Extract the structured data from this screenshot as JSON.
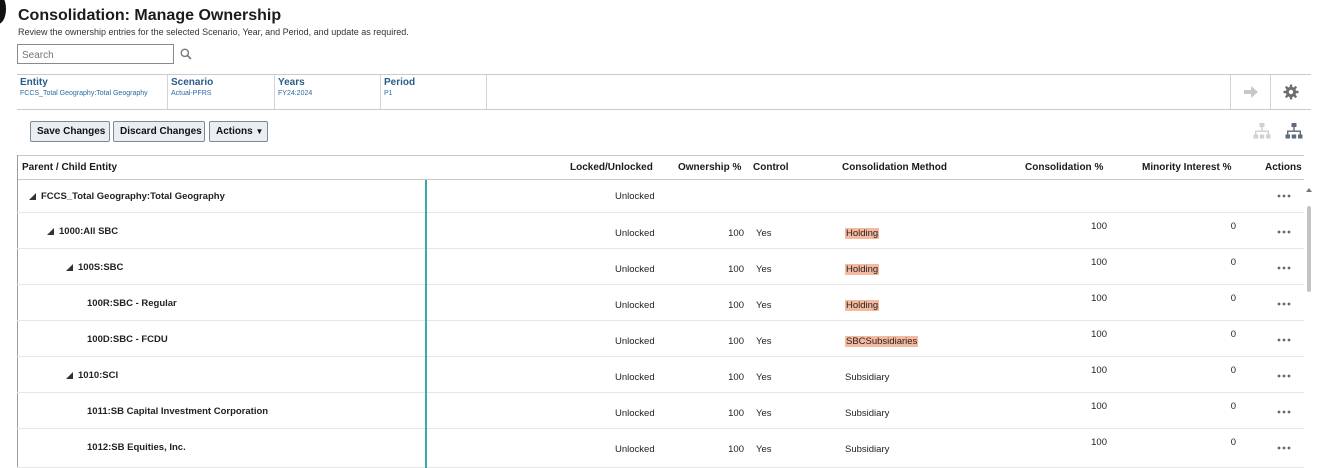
{
  "header": {
    "title": "Consolidation: Manage Ownership",
    "description": "Review the ownership entries for the selected Scenario, Year, and Period, and update as required."
  },
  "search": {
    "placeholder": "Search"
  },
  "pov": [
    {
      "label": "Entity",
      "value": "FCCS_Total Geography:Total Geography"
    },
    {
      "label": "Scenario",
      "value": "Actual-PFRS"
    },
    {
      "label": "Years",
      "value": "FY24:2024"
    },
    {
      "label": "Period",
      "value": "P1"
    }
  ],
  "toolbar": {
    "save_label": "Save Changes",
    "discard_label": "Discard Changes",
    "actions_label": "Actions"
  },
  "grid": {
    "columns": {
      "entity": "Parent / Child Entity",
      "locked": "Locked/Unlocked",
      "ownership": "Ownership %",
      "control": "Control",
      "method": "Consolidation Method",
      "consolidation": "Consolidation %",
      "minority": "Minority Interest %",
      "actions": "Actions"
    },
    "rows": [
      {
        "entity": "FCCS_Total Geography:Total Geography",
        "level": 0,
        "expanded": true,
        "locked": "Unlocked",
        "ownership": "",
        "control": "",
        "method": "",
        "highlight": false,
        "consolidation": "",
        "minority": ""
      },
      {
        "entity": "1000:All SBC",
        "level": 1,
        "expanded": true,
        "locked": "Unlocked",
        "ownership": "100",
        "control": "Yes",
        "method": "Holding",
        "highlight": true,
        "consolidation": "100",
        "minority": "0"
      },
      {
        "entity": "100S:SBC",
        "level": 2,
        "expanded": true,
        "locked": "Unlocked",
        "ownership": "100",
        "control": "Yes",
        "method": "Holding",
        "highlight": true,
        "consolidation": "100",
        "minority": "0"
      },
      {
        "entity": "100R:SBC - Regular",
        "level": 3,
        "expanded": false,
        "locked": "Unlocked",
        "ownership": "100",
        "control": "Yes",
        "method": "Holding",
        "highlight": true,
        "consolidation": "100",
        "minority": "0"
      },
      {
        "entity": "100D:SBC - FCDU",
        "level": 3,
        "expanded": false,
        "locked": "Unlocked",
        "ownership": "100",
        "control": "Yes",
        "method": "SBCSubsidiaries",
        "highlight": true,
        "consolidation": "100",
        "minority": "0"
      },
      {
        "entity": "1010:SCI",
        "level": 2,
        "expanded": true,
        "locked": "Unlocked",
        "ownership": "100",
        "control": "Yes",
        "method": "Subsidiary",
        "highlight": false,
        "consolidation": "100",
        "minority": "0"
      },
      {
        "entity": "1011:SB Capital Investment Corporation",
        "level": 3,
        "expanded": false,
        "locked": "Unlocked",
        "ownership": "100",
        "control": "Yes",
        "method": "Subsidiary",
        "highlight": false,
        "consolidation": "100",
        "minority": "0"
      },
      {
        "entity": "1012:SB Equities, Inc.",
        "level": 3,
        "expanded": false,
        "locked": "Unlocked",
        "ownership": "100",
        "control": "Yes",
        "method": "Subsidiary",
        "highlight": false,
        "consolidation": "100",
        "minority": "0"
      }
    ]
  },
  "icons": {
    "search": "search-icon",
    "pov_go": "arrow-right-icon",
    "settings": "gear-icon",
    "hierarchy_disabled": "hierarchy-icon",
    "hierarchy": "org-chart-icon",
    "row_actions": "more-horizontal-icon"
  },
  "colors": {
    "highlight": "#f5b99f",
    "frozen_separator": "#3aa9a8",
    "pov_label": "#2a5c8a",
    "button_bg": "#e9eef3"
  }
}
